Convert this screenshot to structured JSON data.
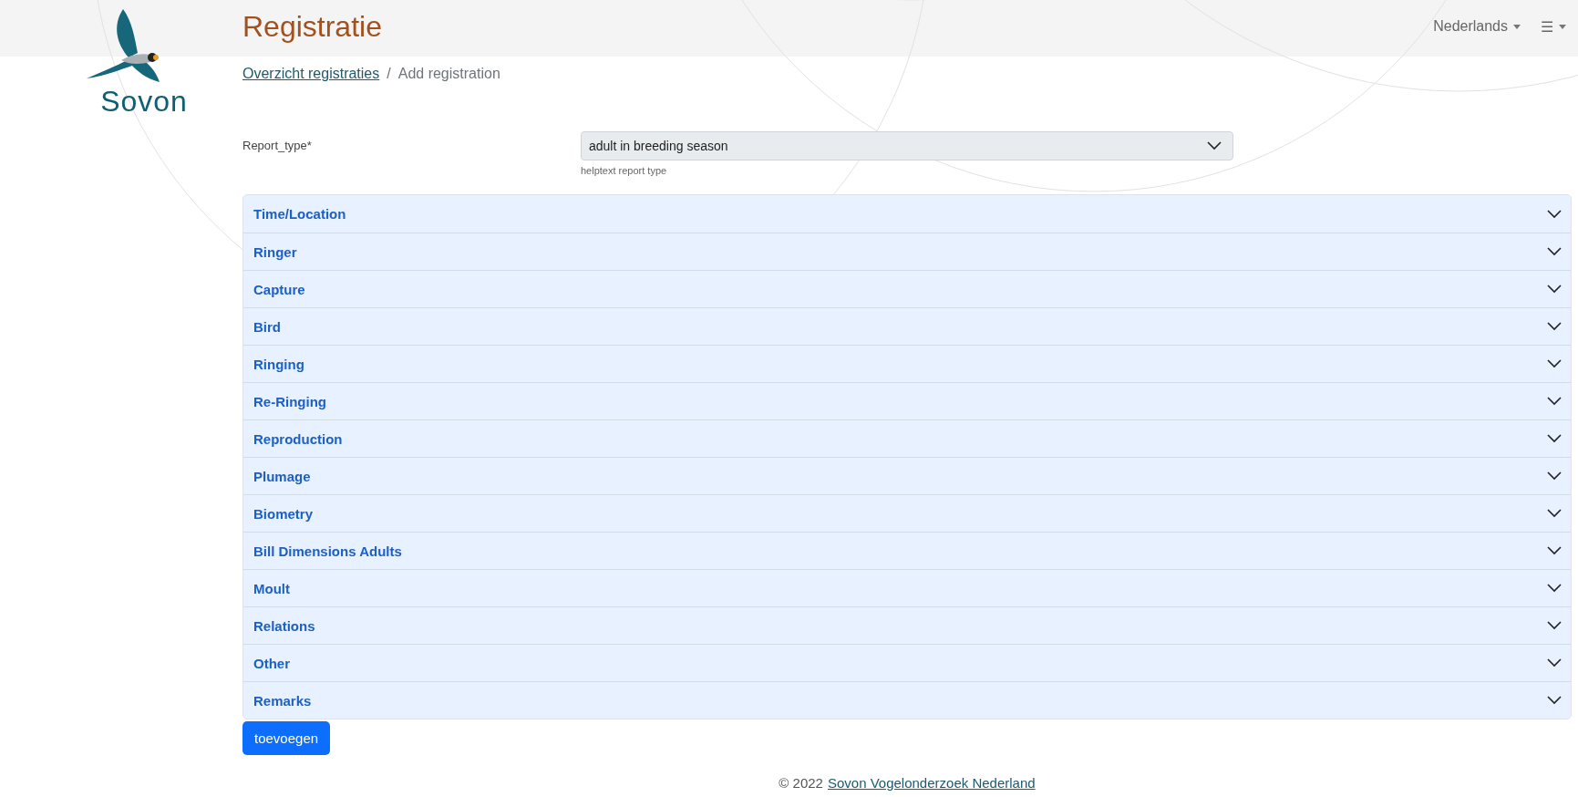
{
  "logo": {
    "text": "Sovon"
  },
  "header": {
    "title": "Registratie",
    "language": "Nederlands",
    "menu": "☰"
  },
  "breadcrumb_separator": "/",
  "breadcrumb": [
    {
      "label": "Overzicht registraties",
      "kind": "link"
    },
    {
      "label": "Add registration",
      "kind": "current"
    }
  ],
  "report_type": {
    "label": "Report_type*",
    "value": "adult in breeding season",
    "help": "helptext report type"
  },
  "sections": [
    {
      "label": "Time/Location",
      "expanded": false
    },
    {
      "label": "Ringer",
      "expanded": false
    },
    {
      "label": "Capture",
      "expanded": false
    },
    {
      "label": "Bird",
      "expanded": false
    },
    {
      "label": "Ringing",
      "expanded": false
    },
    {
      "label": "Re-Ringing",
      "expanded": false
    },
    {
      "label": "Reproduction",
      "expanded": false
    },
    {
      "label": "Plumage",
      "expanded": false
    },
    {
      "label": "Biometry",
      "expanded": false
    },
    {
      "label": "Bill Dimensions Adults",
      "expanded": false
    },
    {
      "label": "Moult",
      "expanded": false
    },
    {
      "label": "Relations",
      "expanded": false
    },
    {
      "label": "Other",
      "expanded": false
    },
    {
      "label": "Remarks",
      "expanded": false
    }
  ],
  "submit": "toevoegen",
  "footer": {
    "text": "© 2022",
    "link": "Sovon Vogelonderzoek Nederland"
  }
}
